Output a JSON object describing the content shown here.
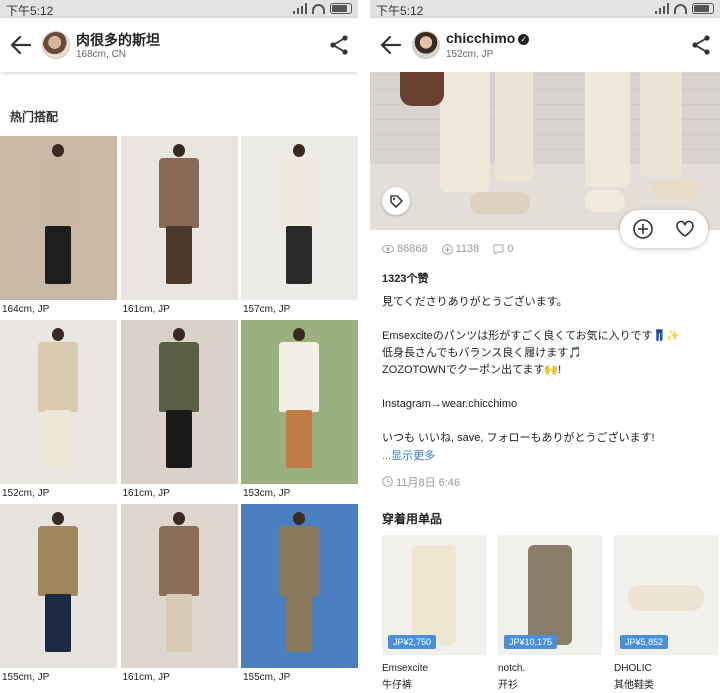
{
  "left_screen": {
    "status_time": "下午5:12",
    "header": {
      "name": "肉很多的斯坦",
      "meta": "168cm, CN"
    },
    "section_title": "热门搭配",
    "outfits": [
      {
        "caption": "164cm, JP",
        "bg": "#c9b9a6",
        "coat": "#c8b8a3",
        "legs": "#1e1e1e"
      },
      {
        "caption": "161cm, JP",
        "bg": "#e9e6e2",
        "coat": "#8a6a52",
        "legs": "#4b3a2c"
      },
      {
        "caption": "157cm, JP",
        "bg": "#ecebe8",
        "coat": "#efe9df",
        "legs": "#2a2a2a"
      },
      {
        "caption": "152cm, JP",
        "bg": "#eae7e3",
        "coat": "#d9c9b0",
        "legs": "#efe7d6"
      },
      {
        "caption": "161cm, JP",
        "bg": "#d9d2c8",
        "coat": "#5a6043",
        "legs": "#1a1a1a"
      },
      {
        "caption": "153cm, JP",
        "bg": "#9bb07f",
        "coat": "#f3eee6",
        "legs": "#c27a45"
      },
      {
        "caption": "155cm, JP",
        "bg": "#e6e3df",
        "coat": "#a0875a",
        "legs": "#1d2a44"
      },
      {
        "caption": "161cm, JP",
        "bg": "#ddd6cd",
        "coat": "#8a6d56",
        "legs": "#d8cab4"
      },
      {
        "caption": "155cm, JP",
        "bg": "#4a7fc0",
        "coat": "#8a7a5c",
        "legs": "#8a7a5c"
      }
    ]
  },
  "right_screen": {
    "status_time": "下午5:12",
    "header": {
      "name": "chicchimo",
      "meta": "152cm, JP"
    },
    "stats": {
      "views": "86868",
      "saves": "1138",
      "comments": "0"
    },
    "likes": "1323个赞",
    "description": [
      "見てくださりありがとうございます。",
      "",
      "Emsexciteのパンツは形がすごく良くてお気に入りです👖✨",
      "低身長さんでもバランス良く履けます🎵",
      "ZOZOTOWNでクーポン出てます🙌!",
      "",
      "Instagram→wear.chicchimo",
      "",
      "いつも いいね, save, フォローもありがとうございます!"
    ],
    "show_more": "...显示更多",
    "post_time": "11月8日 6:46",
    "items_title": "穿着用单品",
    "items": [
      {
        "price": "JP¥2,750",
        "brand": "Emsexcite",
        "category": "牛仔裤",
        "color": "#efe6d2"
      },
      {
        "price": "JP¥10,175",
        "brand": "notch.",
        "category": "开衫",
        "color": "#8a7f66"
      },
      {
        "price": "JP¥5,852",
        "brand": "DHOLIC",
        "category": "其他鞋类",
        "color": "#ece3d3"
      }
    ]
  },
  "colors": {
    "accent": "#4a90d9",
    "link": "#2d7fd8"
  }
}
